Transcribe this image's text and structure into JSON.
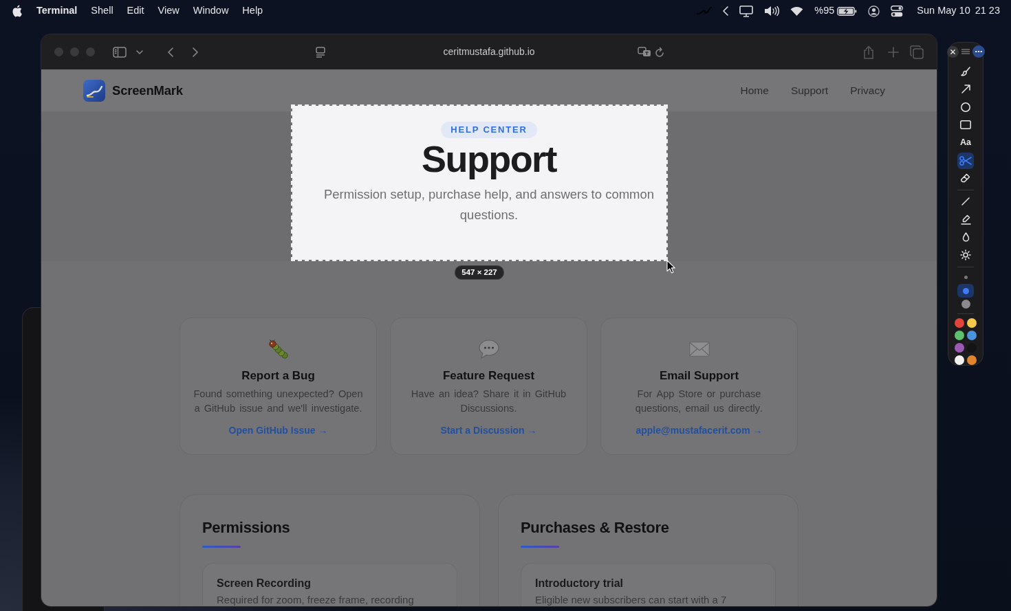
{
  "menu_bar": {
    "app_name": "Terminal",
    "menus": [
      "Shell",
      "Edit",
      "View",
      "Window",
      "Help"
    ],
    "battery": "%95",
    "date": "Sun May 10",
    "time": "21 23"
  },
  "browser": {
    "url": "ceritmustafa.github.io"
  },
  "site": {
    "brand": "ScreenMark",
    "nav": [
      "Home",
      "Support",
      "Privacy"
    ],
    "hero": {
      "badge": "HELP CENTER",
      "title": "Support",
      "subtitle": "Permission setup, purchase help, and answers to common questions."
    },
    "cards": [
      {
        "kind": "bug",
        "title": "Report a Bug",
        "text": "Found something unexpected? Open a GitHub issue and we'll investigate.",
        "link": "Open GitHub Issue →"
      },
      {
        "kind": "chat",
        "title": "Feature Request",
        "text": "Have an idea? Share it in GitHub Discussions.",
        "link": "Start a Discussion →"
      },
      {
        "kind": "mail",
        "title": "Email Support",
        "text": "For App Store or purchase questions, email us directly.",
        "link": "apple@mustafacerit.com →"
      }
    ],
    "sections": [
      {
        "title": "Permissions",
        "items": [
          {
            "title": "Screen Recording",
            "text": "Required for zoom, freeze frame, recording"
          }
        ]
      },
      {
        "title": "Purchases & Restore",
        "items": [
          {
            "title": "Introductory trial",
            "text": "Eligible new subscribers can start with a 7"
          }
        ]
      }
    ]
  },
  "capture": {
    "size": "547 × 227"
  },
  "annotation_palette": {
    "tools": [
      {
        "kind": "brush",
        "selected": false
      },
      {
        "kind": "arrow",
        "selected": false
      },
      {
        "kind": "circle",
        "selected": false
      },
      {
        "kind": "rectangle",
        "selected": false
      },
      {
        "kind": "text",
        "label": "Aa",
        "selected": false
      },
      {
        "kind": "scissors",
        "selected": true
      },
      {
        "kind": "eraser",
        "selected": false
      }
    ],
    "effects": [
      {
        "kind": "line",
        "selected": false
      },
      {
        "kind": "highlighter",
        "selected": false
      },
      {
        "kind": "drop",
        "selected": false
      },
      {
        "kind": "sun",
        "selected": false
      }
    ],
    "sizes": [
      {
        "kind": "small",
        "selected": false
      },
      {
        "kind": "medium",
        "selected": true
      },
      {
        "kind": "large",
        "selected": false
      }
    ],
    "colors": [
      {
        "color": "#e0443a"
      },
      {
        "color": "#f5c84c"
      },
      {
        "color": "#5cc06c"
      },
      {
        "color": "#4a94dc"
      },
      {
        "color": "#9b59b6"
      },
      {
        "color": "#131318"
      },
      {
        "color": "#f2f2f2"
      },
      {
        "color": "#e0852e"
      }
    ]
  }
}
